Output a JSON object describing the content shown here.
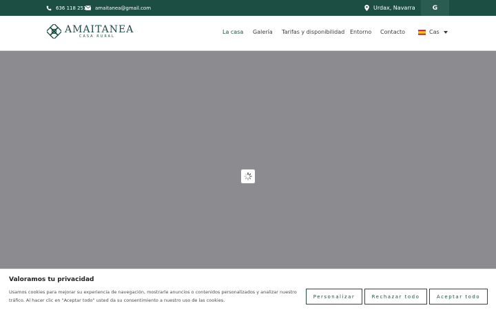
{
  "topbar": {
    "phone": "636 118 251",
    "email": "amaitanea@gmail.com",
    "location": "Urdax, Navarra",
    "google_label": "G"
  },
  "logo": {
    "title": "AMAITANEA",
    "subtitle": "CASA RURAL"
  },
  "nav": {
    "items": [
      {
        "label": "La casa",
        "active": true
      },
      {
        "label": "Galería",
        "active": false
      },
      {
        "label": "Tarifas y disponibilidad",
        "active": false
      },
      {
        "label": "Entorno",
        "active": false
      },
      {
        "label": "Contacto",
        "active": false
      }
    ],
    "language": "Cas"
  },
  "cookie": {
    "title": "Valoramos tu privacidad",
    "text": "Usamos cookies para mejorar su experiencia de navegación, mostrarle anuncios o contenidos personalizados y analizar nuestro tráfico. Al hacer clic en \"Aceptar todo\" usted da su consentimiento a nuestro uso de las cookies.",
    "customize": "Personalizar",
    "reject": "Rechazar todo",
    "accept": "Aceptar todo"
  },
  "colors": {
    "brand": "#1c4e44",
    "hero_placeholder": "#8b8b90"
  }
}
